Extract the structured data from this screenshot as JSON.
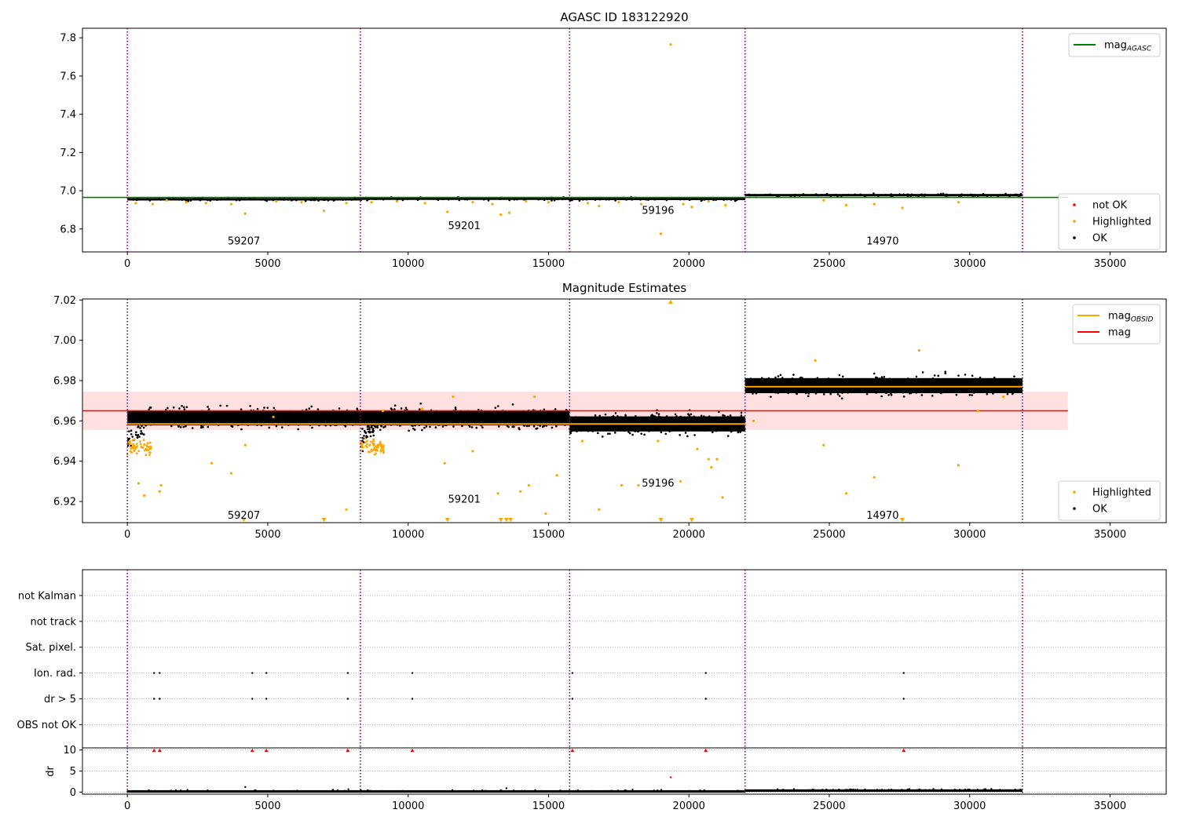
{
  "chart_data": [
    {
      "type": "scatter",
      "title": "AGASC ID 183122920",
      "xlim": [
        -1600,
        37000
      ],
      "ylim": [
        6.68,
        7.85
      ],
      "xticks": [
        0,
        5000,
        10000,
        15000,
        20000,
        25000,
        30000,
        35000
      ],
      "xtick_labels": [
        "0",
        "5000",
        "10000",
        "15000",
        "20000",
        "25000",
        "30000",
        "35000"
      ],
      "yticks": [
        6.8,
        7.0,
        7.2,
        7.4,
        7.6,
        7.8
      ],
      "ytick_labels": [
        "6.8",
        "7.0",
        "7.2",
        "7.4",
        "7.6",
        "7.8"
      ],
      "obs_boundaries": [
        0,
        8300,
        15750,
        22000,
        31880
      ],
      "obs_labels": [
        {
          "text": "59207",
          "x": 4150,
          "y": 6.735
        },
        {
          "text": "59201",
          "x": 12000,
          "y": 6.815
        },
        {
          "text": "59196",
          "x": 18900,
          "y": 6.895
        },
        {
          "text": "14970",
          "x": 26900,
          "y": 6.735
        }
      ],
      "segments": [
        {
          "start": 0,
          "end": 8300,
          "level": 6.955
        },
        {
          "start": 8300,
          "end": 15750,
          "level": 6.958
        },
        {
          "start": 15750,
          "end": 22000,
          "level": 6.957
        },
        {
          "start": 22000,
          "end": 31880,
          "level": 6.977
        }
      ],
      "reference_line": {
        "value": 6.965,
        "xmin": -1600,
        "xmax": 33500,
        "color": "#008000"
      },
      "highlighted_points": [
        [
          300,
          6.935
        ],
        [
          900,
          6.93
        ],
        [
          1400,
          6.95
        ],
        [
          2100,
          6.94
        ],
        [
          2800,
          6.935
        ],
        [
          3700,
          6.93
        ],
        [
          4200,
          6.88
        ],
        [
          5300,
          6.945
        ],
        [
          6200,
          6.94
        ],
        [
          7000,
          6.895
        ],
        [
          7800,
          6.935
        ],
        [
          8700,
          6.94
        ],
        [
          9600,
          6.945
        ],
        [
          10600,
          6.935
        ],
        [
          11400,
          6.89
        ],
        [
          12300,
          6.94
        ],
        [
          13000,
          6.93
        ],
        [
          13300,
          6.875
        ],
        [
          13600,
          6.885
        ],
        [
          14200,
          6.945
        ],
        [
          15000,
          6.94
        ],
        [
          16400,
          6.935
        ],
        [
          16800,
          6.92
        ],
        [
          17500,
          6.94
        ],
        [
          18300,
          6.93
        ],
        [
          19000,
          6.775
        ],
        [
          19350,
          7.765
        ],
        [
          19800,
          6.93
        ],
        [
          20100,
          6.915
        ],
        [
          20700,
          6.945
        ],
        [
          21300,
          6.925
        ],
        [
          24800,
          6.95
        ],
        [
          25600,
          6.925
        ],
        [
          26600,
          6.93
        ],
        [
          27600,
          6.91
        ],
        [
          29600,
          6.94
        ]
      ],
      "legend_top": [
        {
          "label": "mag",
          "sub": "AGASC",
          "color": "#008000"
        }
      ],
      "legend_bottom": [
        {
          "label": "not OK",
          "color": "#ff0000"
        },
        {
          "label": "Highlighted",
          "color": "#ffa500"
        },
        {
          "label": "OK",
          "color": "#000000"
        }
      ]
    },
    {
      "type": "scatter",
      "title": "Magnitude Estimates",
      "xlim": [
        -1600,
        37000
      ],
      "ylim": [
        6.9095,
        7.0205
      ],
      "xticks": [
        0,
        5000,
        10000,
        15000,
        20000,
        25000,
        30000,
        35000
      ],
      "xtick_labels": [
        "0",
        "5000",
        "10000",
        "15000",
        "20000",
        "25000",
        "30000",
        "35000"
      ],
      "yticks": [
        6.92,
        6.94,
        6.96,
        6.98,
        7.0,
        7.02
      ],
      "ytick_labels": [
        "6.92",
        "6.94",
        "6.96",
        "6.98",
        "7.00",
        "7.02"
      ],
      "obs_boundaries": [
        0,
        8300,
        15750,
        22000,
        31880
      ],
      "obs_labels": [
        {
          "text": "59207",
          "x": 4150,
          "y": 6.913
        },
        {
          "text": "59201",
          "x": 12000,
          "y": 6.921
        },
        {
          "text": "59196",
          "x": 18900,
          "y": 6.929
        },
        {
          "text": "14970",
          "x": 26900,
          "y": 6.913
        }
      ],
      "segments": [
        {
          "start": 0,
          "end": 8300,
          "level": 6.9615,
          "rise": 800
        },
        {
          "start": 8300,
          "end": 15750,
          "level": 6.9615,
          "rise": 800
        },
        {
          "start": 15750,
          "end": 22000,
          "level": 6.9585,
          "rise": 0
        },
        {
          "start": 22000,
          "end": 31880,
          "level": 6.9775,
          "rise": 0
        }
      ],
      "obsid_mag_lines": [
        {
          "start": 0,
          "end": 8300,
          "value": 6.9585
        },
        {
          "start": 8300,
          "end": 15750,
          "value": 6.9585
        },
        {
          "start": 15750,
          "end": 22000,
          "value": 6.9585
        },
        {
          "start": 22000,
          "end": 31880,
          "value": 6.977
        }
      ],
      "mag_line": {
        "value": 6.965,
        "band_low": 6.9555,
        "band_high": 6.9745,
        "xmin": -1600,
        "xmax": 33500,
        "color": "#ff0000"
      },
      "highlighted_points": [
        [
          400,
          6.929
        ],
        [
          600,
          6.923
        ],
        [
          1200,
          6.928
        ],
        [
          1150,
          6.925
        ],
        [
          3000,
          6.939
        ],
        [
          3700,
          6.934
        ],
        [
          4200,
          6.948
        ],
        [
          5200,
          6.962
        ],
        [
          7800,
          6.916
        ],
        [
          9100,
          6.965
        ],
        [
          10500,
          6.966
        ],
        [
          11300,
          6.939
        ],
        [
          11600,
          6.972
        ],
        [
          12300,
          6.945
        ],
        [
          13200,
          6.924
        ],
        [
          14000,
          6.925
        ],
        [
          14300,
          6.928
        ],
        [
          14500,
          6.972
        ],
        [
          14900,
          6.914
        ],
        [
          15300,
          6.933
        ],
        [
          16200,
          6.95
        ],
        [
          16800,
          6.916
        ],
        [
          17600,
          6.928
        ],
        [
          18200,
          6.928
        ],
        [
          18900,
          6.95
        ],
        [
          19700,
          6.93
        ],
        [
          20300,
          6.946
        ],
        [
          20700,
          6.941
        ],
        [
          20800,
          6.937
        ],
        [
          21000,
          6.941
        ],
        [
          21200,
          6.922
        ],
        [
          22300,
          6.96
        ],
        [
          24500,
          6.99
        ],
        [
          24800,
          6.948
        ],
        [
          25600,
          6.924
        ],
        [
          26600,
          6.932
        ],
        [
          28200,
          6.995
        ],
        [
          29600,
          6.938
        ],
        [
          30300,
          6.965
        ],
        [
          31200,
          6.972
        ]
      ],
      "clipped_points": [
        4150,
        7000,
        11400,
        13300,
        13500,
        13650,
        19000,
        20100,
        27600
      ],
      "clipped_top_points": [
        19350
      ],
      "legend_top": [
        {
          "label": "mag",
          "sub": "OBSID",
          "color": "#ffa500"
        },
        {
          "label": "mag",
          "sub": "",
          "color": "#ff0000"
        }
      ],
      "legend_bottom": [
        {
          "label": "Highlighted",
          "color": "#ffa500"
        },
        {
          "label": "OK",
          "color": "#000000"
        }
      ]
    },
    {
      "type": "scatter",
      "title": "",
      "xlim": [
        -1600,
        37000
      ],
      "flag_labels": [
        "not Kalman",
        "not track",
        "Sat. pixel.",
        "Ion. rad.",
        "dr > 5",
        "OBS not OK"
      ],
      "flag_points": {
        "Ion. rad.": [
          950,
          1150,
          4450,
          4950,
          7850,
          10150,
          15850,
          20600,
          27650
        ],
        "dr > 5": [
          950,
          1150,
          4450,
          4950,
          7850,
          10150,
          15850,
          20600,
          27650
        ]
      },
      "obs_boundaries": [
        0,
        8300,
        15750,
        22000,
        31880
      ]
    },
    {
      "type": "scatter",
      "title": "",
      "ylabel": "dr",
      "xlim": [
        -1600,
        37000
      ],
      "ylim": [
        -0.5,
        10.5
      ],
      "xticks": [
        0,
        5000,
        10000,
        15000,
        20000,
        25000,
        30000,
        35000
      ],
      "xtick_labels": [
        "0",
        "5000",
        "10000",
        "15000",
        "20000",
        "25000",
        "30000",
        "35000"
      ],
      "yticks": [
        0,
        5,
        10
      ],
      "ytick_labels": [
        "0",
        "5",
        "10"
      ],
      "obs_boundaries": [
        0,
        8300,
        15750,
        22000,
        31880
      ],
      "clipped_points": [
        950,
        1150,
        4450,
        4950,
        7850,
        10150,
        15850,
        20600,
        27650
      ],
      "outlier_points": [
        [
          19350,
          3.5
        ],
        [
          4200,
          1.2
        ],
        [
          13500,
          0.9
        ]
      ]
    }
  ]
}
